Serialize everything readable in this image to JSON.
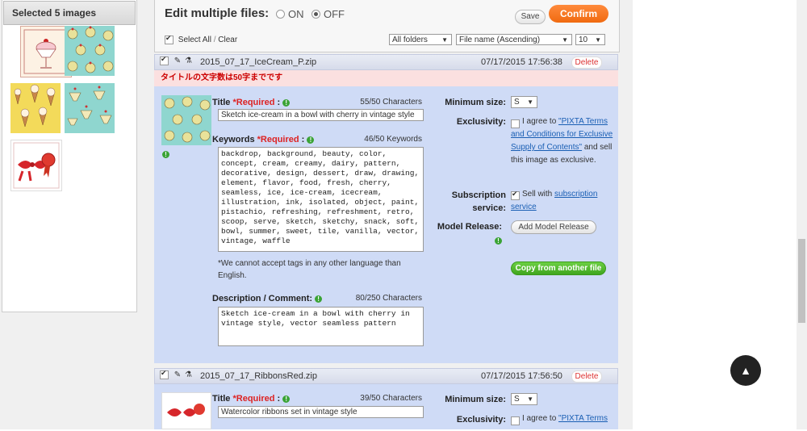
{
  "left": {
    "header": "Selected 5 images"
  },
  "topbar": {
    "edit_label": "Edit multiple files:",
    "on_label": "ON",
    "off_label": "OFF",
    "save_label": "Save",
    "confirm_label": "Confirm",
    "select_all": "Select All",
    "separator": "/",
    "clear": "Clear",
    "folder_select": "All folders",
    "sort_select": "File name (Ascending)",
    "per_page_select": "10"
  },
  "file1": {
    "name": "2015_07_17_IceCream_P.zip",
    "date": "07/17/2015 17:56:38",
    "delete": "Delete",
    "error": "タイトルの文字数は50字までです",
    "title_label": "Title",
    "required": "*Required",
    "colon": ":",
    "title_count": "55/50 Characters",
    "title_value": "Sketch ice-cream in a bowl with cherry in vintage style",
    "keywords_label": "Keywords",
    "keywords_count": "46/50 Keywords",
    "keywords_value": "backdrop, background, beauty, color, concept, cream, creamy, dairy, pattern, decorative, design, dessert, draw, drawing, element, flavor, food, fresh, cherry, seamless, ice, ice-cream, icecream, illustration, ink, isolated, object, paint, pistachio, refreshing, refreshment, retro, scoop, serve, sketch, sketchy, snack, soft, bowl, summer, sweet, tile, vanilla, vector, vintage, waffle",
    "lang_note": "*We cannot accept tags in any other language than English.",
    "desc_label": "Description / Comment:",
    "desc_count": "80/250 Characters",
    "desc_value": "Sketch ice-cream in a bowl with cherry in vintage style, vector seamless pattern",
    "min_size_label": "Minimum size:",
    "min_size_value": "S",
    "exclusivity_label": "Exclusivity:",
    "exclusivity_pre": "I agree to ",
    "exclusivity_link": "\"PIXTA Terms and Conditions for Exclusive Supply of Contents\"",
    "exclusivity_post": " and sell this image as exclusive.",
    "subscription_label": "Subscription service:",
    "subscription_pre": "Sell with ",
    "subscription_link": "subscription service",
    "model_release_label": "Model Release:",
    "model_release_btn": "Add Model Release",
    "copy_btn": "Copy from another file"
  },
  "file2": {
    "name": "2015_07_17_RibbonsRed.zip",
    "date": "07/17/2015 17:56:50",
    "delete": "Delete",
    "title_label": "Title",
    "required": "*Required",
    "colon": ":",
    "title_count": "39/50 Characters",
    "title_value": "Watercolor ribbons set in vintage style",
    "min_size_label": "Minimum size:",
    "min_size_value": "S",
    "exclusivity_label": "Exclusivity:",
    "exclusivity_pre": "I agree to ",
    "exclusivity_link": "\"PIXTA Terms"
  },
  "colors": {
    "confirm": "#f06a10",
    "copy_button": "#4fb82d",
    "panel": "#cfdbf6",
    "error_bg": "#fbe0e0",
    "required": "#d22222"
  }
}
